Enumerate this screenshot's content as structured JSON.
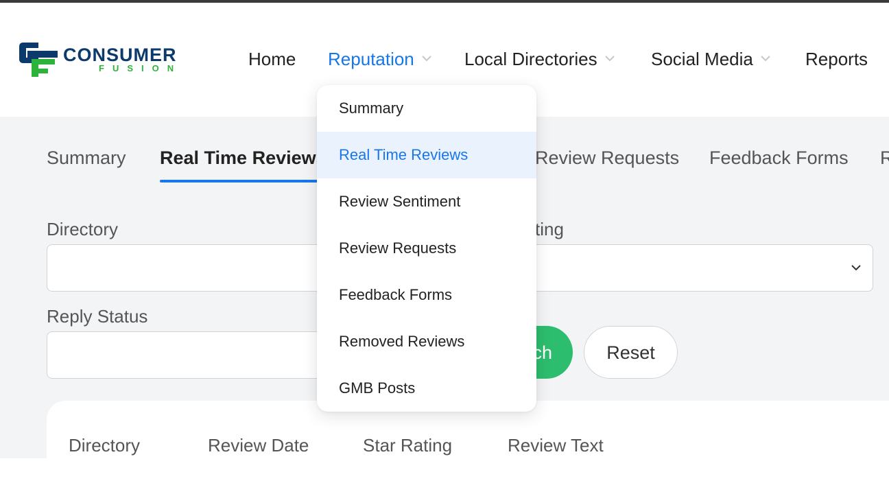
{
  "logo": {
    "name": "CONSUMER",
    "tagline": "FUSION",
    "colors": {
      "primary": "#0b3a6b",
      "secondary": "#2eb33a"
    }
  },
  "nav": {
    "items": [
      {
        "label": "Home",
        "has_dropdown": false,
        "active": false
      },
      {
        "label": "Reputation",
        "has_dropdown": true,
        "active": true
      },
      {
        "label": "Local Directories",
        "has_dropdown": true,
        "active": false
      },
      {
        "label": "Social Media",
        "has_dropdown": true,
        "active": false
      },
      {
        "label": "Reports",
        "has_dropdown": false,
        "active": false
      }
    ],
    "accent_color": "#1877e8"
  },
  "dropdown": {
    "items": [
      {
        "label": "Summary"
      },
      {
        "label": "Real Time Reviews",
        "active": true
      },
      {
        "label": "Review Sentiment"
      },
      {
        "label": "Review Requests"
      },
      {
        "label": "Feedback Forms"
      },
      {
        "label": "Removed Reviews"
      },
      {
        "label": "GMB Posts"
      }
    ]
  },
  "tabs": {
    "items": [
      {
        "label": "Summary"
      },
      {
        "label": "Real Time Reviews",
        "active": true
      },
      {
        "label": "Review Requests"
      },
      {
        "label": "Feedback Forms"
      },
      {
        "label": "R"
      }
    ]
  },
  "filters": {
    "directory_label": "Directory",
    "rating_label_visible": "ting",
    "reply_status_label": "Reply Status",
    "directory_value": "",
    "rating_value": "",
    "reply_status_value": "",
    "search_label_visible": "ch",
    "reset_label": "Reset",
    "search_color": "#2dbd6e"
  },
  "table": {
    "headers": [
      "Directory",
      "Review Date",
      "Star Rating",
      "Review Text"
    ]
  }
}
